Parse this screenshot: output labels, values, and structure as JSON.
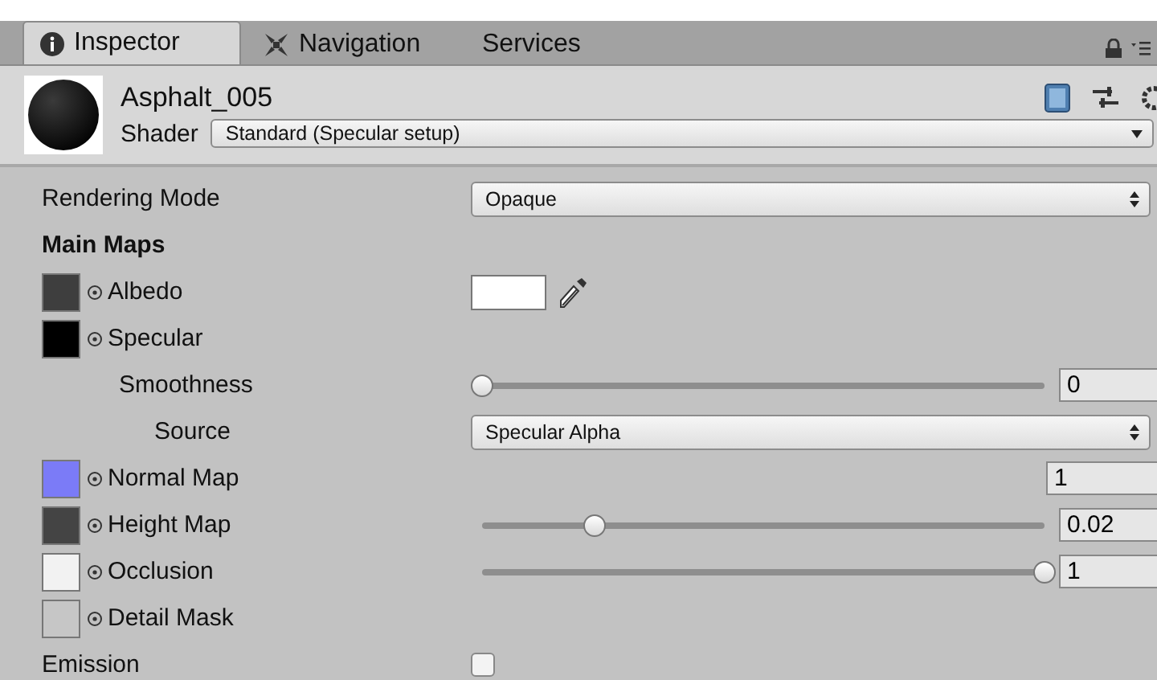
{
  "tabs": [
    {
      "label": "Inspector",
      "selected": true
    },
    {
      "label": "Navigation",
      "selected": false
    },
    {
      "label": "Services",
      "selected": false
    }
  ],
  "material": {
    "name": "Asphalt_005",
    "shader_label": "Shader",
    "shader": "Standard (Specular setup)"
  },
  "rows": [
    {
      "kind": "dropdown",
      "label": "Rendering Mode",
      "value": "Opaque"
    },
    {
      "kind": "header",
      "label": "Main Maps"
    },
    {
      "kind": "color",
      "label": "Albedo",
      "color": "#3e3e3e"
    },
    {
      "kind": "none",
      "label": "Specular",
      "color": "#000000",
      "children": [
        {
          "kind": "slider",
          "label": "Smoothness",
          "level": 0,
          "reading": "0",
          "children": [
            {
              "kind": "dropdown",
              "label": "Source",
              "value": "Specular Alpha"
            }
          ]
        }
      ]
    },
    {
      "kind": "number",
      "label": "Normal Map",
      "color": "#7b7bf7",
      "reading": "1"
    },
    {
      "kind": "slider",
      "label": "Height Map",
      "color": "#444444",
      "level": 0.2,
      "reading": "0.02"
    },
    {
      "kind": "slider",
      "label": "Occlusion",
      "color": "#f2f2f2",
      "level": 1,
      "reading": "1"
    },
    {
      "kind": "none",
      "label": "Detail Mask",
      "color": "#c6c6c6"
    },
    {
      "kind": "checkbox",
      "label": "Emission",
      "checked": false
    }
  ]
}
